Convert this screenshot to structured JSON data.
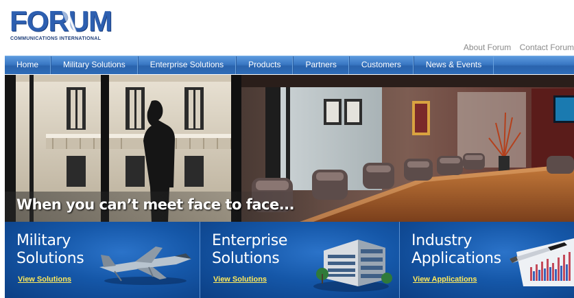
{
  "logo": {
    "wordmark": "FORUM",
    "tagline": "COMMUNICATIONS INTERNATIONAL"
  },
  "utility_links": [
    "About Forum",
    "Contact Forum"
  ],
  "nav": {
    "items": [
      "Home",
      "Military Solutions",
      "Enterprise Solutions",
      "Products",
      "Partners",
      "Customers",
      "News & Events"
    ]
  },
  "hero": {
    "caption": "When you can’t meet face to face..."
  },
  "features": [
    {
      "title_line1": "Military",
      "title_line2": "Solutions",
      "link": "View Solutions",
      "icon": "fighter-jet-icon"
    },
    {
      "title_line1": "Enterprise",
      "title_line2": "Solutions",
      "link": "View Solutions",
      "icon": "office-building-icon"
    },
    {
      "title_line1": "Industry",
      "title_line2": "Applications",
      "link": "View Applications",
      "icon": "pen-chart-icon"
    }
  ],
  "colors": {
    "nav_blue": "#3a78c4",
    "feature_blue": "#1557a8",
    "link_yellow": "#ffe95a",
    "logo_blue": "#2d5fb0"
  }
}
